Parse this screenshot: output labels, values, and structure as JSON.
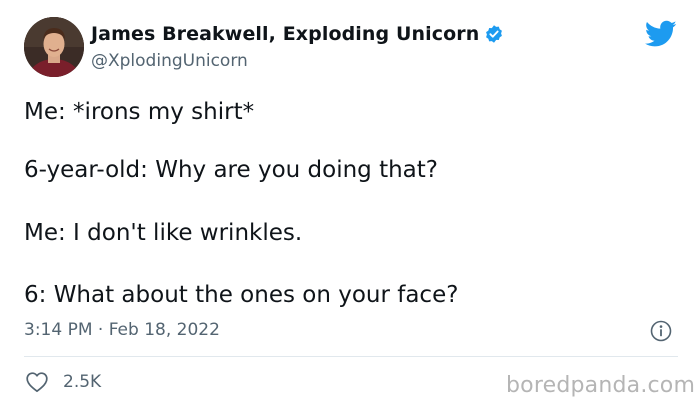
{
  "author": {
    "display_name": "James Breakwell, Exploding Unicorn",
    "handle": "@XplodingUnicorn",
    "verified": true,
    "avatar": "profile-photo"
  },
  "tweet": {
    "lines": [
      "Me: *irons my shirt*",
      "6-year-old: Why are you doing that?",
      "Me: I don't like wrinkles.",
      "6: What about the ones on your face?"
    ],
    "timestamp": "3:14 PM · Feb 18, 2022"
  },
  "stats": {
    "likes": "2.5K"
  },
  "icons": {
    "brand": "twitter-bird-icon",
    "verified": "verified-badge-icon",
    "info": "info-icon",
    "like": "heart-icon"
  },
  "watermark": "boredpanda.com",
  "colors": {
    "twitter_blue": "#1d9bf0",
    "text_primary": "#0f1419",
    "text_secondary": "#536471",
    "divider": "#e1e8ed",
    "watermark": "#b5b5b5"
  }
}
